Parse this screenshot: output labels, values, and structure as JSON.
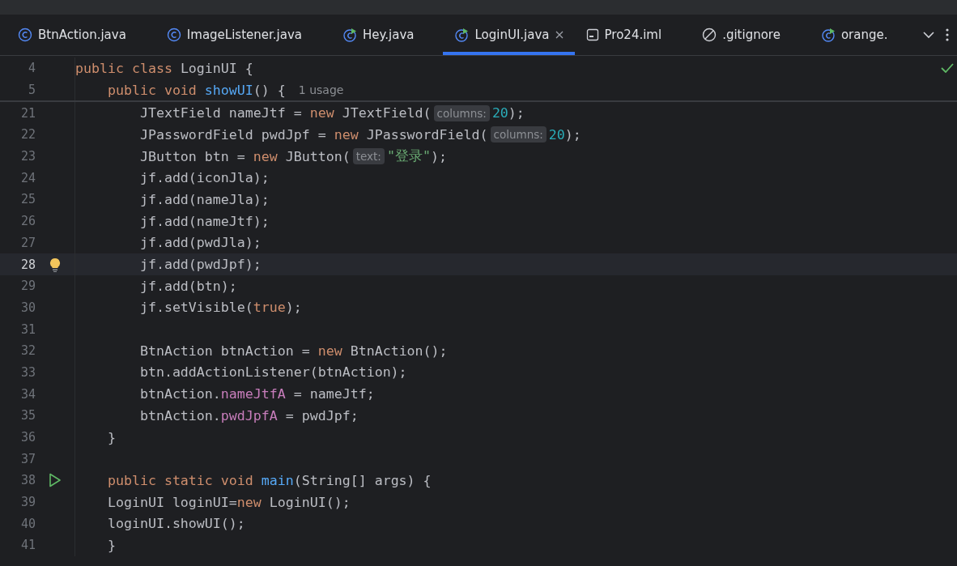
{
  "tabs": [
    {
      "label": "BtnAction.java",
      "kind": "class",
      "selected": false,
      "closable": false
    },
    {
      "label": "ImageListener.java",
      "kind": "class",
      "selected": false,
      "closable": false
    },
    {
      "label": "Hey.java",
      "kind": "runnable",
      "selected": false,
      "closable": false
    },
    {
      "label": "LoginUI.java",
      "kind": "runnable",
      "selected": true,
      "closable": true
    },
    {
      "label": "Pro24.iml",
      "kind": "module",
      "selected": false,
      "closable": false
    },
    {
      "label": ".gitignore",
      "kind": "ignore",
      "selected": false,
      "closable": false
    },
    {
      "label": "orange.",
      "kind": "runnable",
      "selected": false,
      "closable": false
    }
  ],
  "sticky_lines": [
    {
      "number": "4",
      "tokens": [
        {
          "kind": "keyword",
          "text": "public class "
        },
        {
          "kind": "plain",
          "text": "LoginUI {"
        }
      ]
    },
    {
      "number": "5",
      "tokens": [
        {
          "kind": "keyword",
          "text": "    public void "
        },
        {
          "kind": "method",
          "text": "showUI"
        },
        {
          "kind": "plain",
          "text": "() {"
        },
        {
          "kind": "usage",
          "text": "1 usage"
        }
      ]
    }
  ],
  "lines": [
    {
      "number": "21",
      "highlighted": false,
      "tokens": [
        {
          "kind": "plain",
          "text": "        JTextField nameJtf = "
        },
        {
          "kind": "keyword",
          "text": "new "
        },
        {
          "kind": "plain",
          "text": "JTextField("
        },
        {
          "kind": "hint",
          "text": "columns:"
        },
        {
          "kind": "number",
          "text": "20"
        },
        {
          "kind": "plain",
          "text": ");"
        }
      ]
    },
    {
      "number": "22",
      "highlighted": false,
      "tokens": [
        {
          "kind": "plain",
          "text": "        JPasswordField pwdJpf = "
        },
        {
          "kind": "keyword",
          "text": "new "
        },
        {
          "kind": "plain",
          "text": "JPasswordField("
        },
        {
          "kind": "hint",
          "text": "columns:"
        },
        {
          "kind": "number",
          "text": "20"
        },
        {
          "kind": "plain",
          "text": ");"
        }
      ]
    },
    {
      "number": "23",
      "highlighted": false,
      "tokens": [
        {
          "kind": "plain",
          "text": "        JButton btn = "
        },
        {
          "kind": "keyword",
          "text": "new "
        },
        {
          "kind": "plain",
          "text": "JButton("
        },
        {
          "kind": "hint",
          "text": "text:"
        },
        {
          "kind": "string",
          "text": "\"登录\""
        },
        {
          "kind": "plain",
          "text": ");"
        }
      ]
    },
    {
      "number": "24",
      "highlighted": false,
      "tokens": [
        {
          "kind": "plain",
          "text": "        jf.add(iconJla);"
        }
      ]
    },
    {
      "number": "25",
      "highlighted": false,
      "tokens": [
        {
          "kind": "plain",
          "text": "        jf.add(nameJla);"
        }
      ]
    },
    {
      "number": "26",
      "highlighted": false,
      "tokens": [
        {
          "kind": "plain",
          "text": "        jf.add(nameJtf);"
        }
      ]
    },
    {
      "number": "27",
      "highlighted": false,
      "tokens": [
        {
          "kind": "plain",
          "text": "        jf.add(pwdJla);"
        }
      ]
    },
    {
      "number": "28",
      "highlighted": true,
      "marker": {
        "kind": "bulb"
      },
      "tokens": [
        {
          "kind": "plain",
          "text": "        jf.add(pwdJpf);"
        }
      ]
    },
    {
      "number": "29",
      "highlighted": false,
      "tokens": [
        {
          "kind": "plain",
          "text": "        jf.add(btn);"
        }
      ]
    },
    {
      "number": "30",
      "highlighted": false,
      "tokens": [
        {
          "kind": "plain",
          "text": "        jf.setVisible("
        },
        {
          "kind": "keyword",
          "text": "true"
        },
        {
          "kind": "plain",
          "text": ");"
        }
      ]
    },
    {
      "number": "31",
      "highlighted": false
    },
    {
      "number": "32",
      "highlighted": false,
      "tokens": [
        {
          "kind": "plain",
          "text": "        BtnAction btnAction = "
        },
        {
          "kind": "keyword",
          "text": "new "
        },
        {
          "kind": "plain",
          "text": "BtnAction();"
        }
      ]
    },
    {
      "number": "33",
      "highlighted": false,
      "tokens": [
        {
          "kind": "plain",
          "text": "        btn.addActionListener(btnAction);"
        }
      ]
    },
    {
      "number": "34",
      "highlighted": false,
      "tokens": [
        {
          "kind": "plain",
          "text": "        btnAction."
        },
        {
          "kind": "field",
          "text": "nameJtfA"
        },
        {
          "kind": "plain",
          "text": " = nameJtf;"
        }
      ]
    },
    {
      "number": "35",
      "highlighted": false,
      "tokens": [
        {
          "kind": "plain",
          "text": "        btnAction."
        },
        {
          "kind": "field",
          "text": "pwdJpfA"
        },
        {
          "kind": "plain",
          "text": " = pwdJpf;"
        }
      ]
    },
    {
      "number": "36",
      "highlighted": false,
      "tokens": [
        {
          "kind": "plain",
          "text": "    }"
        }
      ]
    },
    {
      "number": "37",
      "highlighted": false
    },
    {
      "number": "38",
      "highlighted": false,
      "marker": {
        "kind": "run"
      },
      "tokens": [
        {
          "kind": "keyword",
          "text": "    public static void "
        },
        {
          "kind": "method",
          "text": "main"
        },
        {
          "kind": "plain",
          "text": "(String[] args) {"
        }
      ]
    },
    {
      "number": "39",
      "highlighted": false,
      "tokens": [
        {
          "kind": "plain",
          "text": "    LoginUI loginUI="
        },
        {
          "kind": "keyword",
          "text": "new "
        },
        {
          "kind": "plain",
          "text": "LoginUI();"
        }
      ]
    },
    {
      "number": "40",
      "highlighted": false,
      "tokens": [
        {
          "kind": "plain",
          "text": "    loginUI.showUI();"
        }
      ]
    },
    {
      "number": "41",
      "highlighted": false,
      "tokens": [
        {
          "kind": "plain",
          "text": "    }"
        }
      ]
    }
  ]
}
